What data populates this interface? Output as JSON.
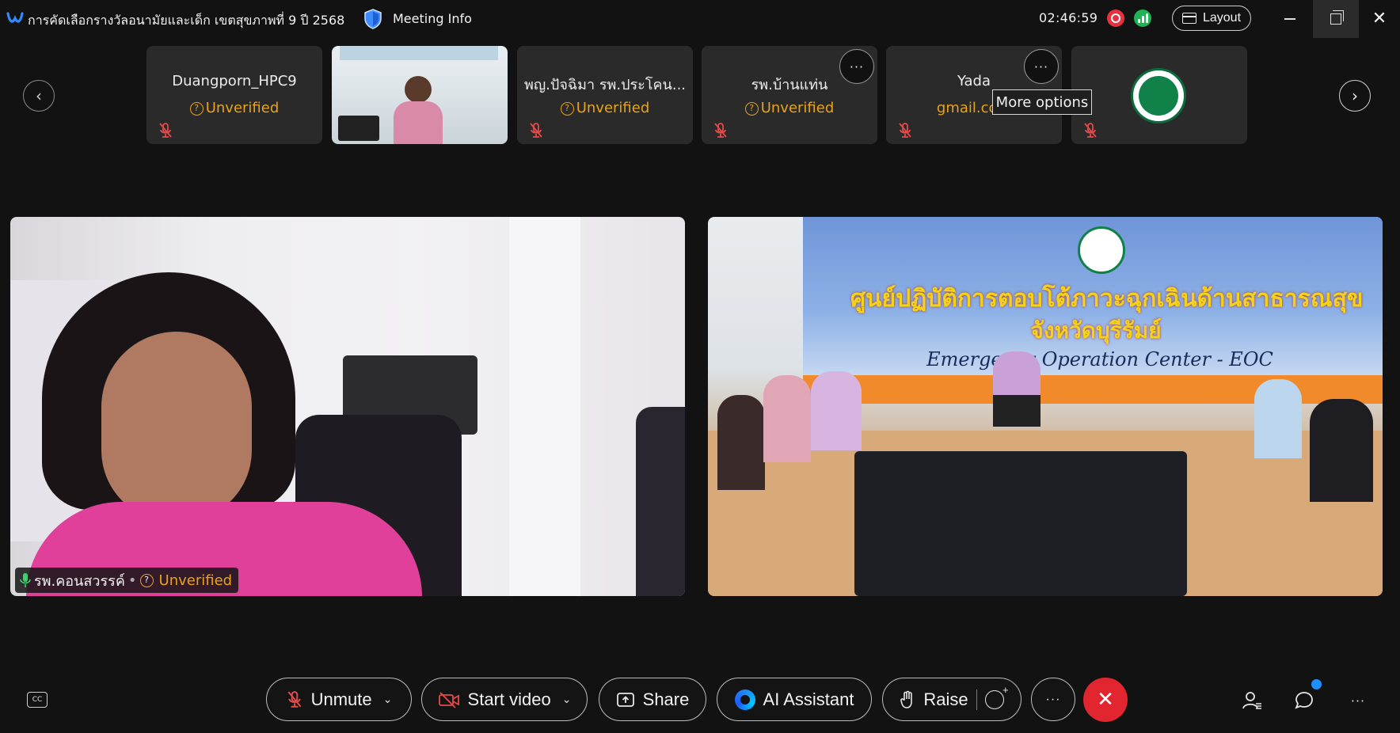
{
  "titlebar": {
    "meeting_title": "การคัดเลือกรางวัลอนามัยและเด็ก เขตสุขภาพที่ 9 ปี 2568",
    "meeting_info": "Meeting Info",
    "timer": "02:46:59",
    "layout_label": "Layout"
  },
  "participants": [
    {
      "name": "Duangporn_HPC9",
      "sub": "Unverified",
      "type": "text"
    },
    {
      "name": "",
      "sub": "",
      "type": "video"
    },
    {
      "name": "พญ.ปัจฉิมา รพ.ประโคน...",
      "sub": "Unverified",
      "type": "text"
    },
    {
      "name": "รพ.บ้านแท่น",
      "sub": "Unverified",
      "type": "text"
    },
    {
      "name": "Yada",
      "sub": "gmail.com",
      "type": "text"
    },
    {
      "name": "",
      "sub": "",
      "type": "logo"
    }
  ],
  "tooltip": "More options",
  "more_glyph": "···",
  "main_left": {
    "name": "รพ.คอนสวรรค์",
    "separator": "•",
    "status": "Unverified"
  },
  "main_right": {
    "banner_line1": "ศูนย์ปฏิบัติการตอบโต้ภาวะฉุกเฉินด้านสาธารณสุข",
    "banner_line2": "จังหวัดบุรีรัมย์",
    "banner_line3": "Emergency Operation Center - EOC"
  },
  "toolbar": {
    "cc": "CC",
    "unmute": "Unmute",
    "start_video": "Start video",
    "share": "Share",
    "ai_assistant": "AI Assistant",
    "raise": "Raise",
    "more": "···",
    "end": "✕",
    "side_more": "···"
  },
  "colors": {
    "background": "#121212",
    "tile": "#2a2a2a",
    "unverified": "#e8a21b",
    "end_call": "#e2262f",
    "record": "#e6323f",
    "signal": "#1fb356",
    "notification": "#1f8fff"
  },
  "icons": {
    "app": "webex-logo-icon",
    "security": "shield-icon",
    "record": "record-icon",
    "signal": "signal-icon",
    "mute": "microphone-muted-icon",
    "mic": "microphone-icon"
  }
}
